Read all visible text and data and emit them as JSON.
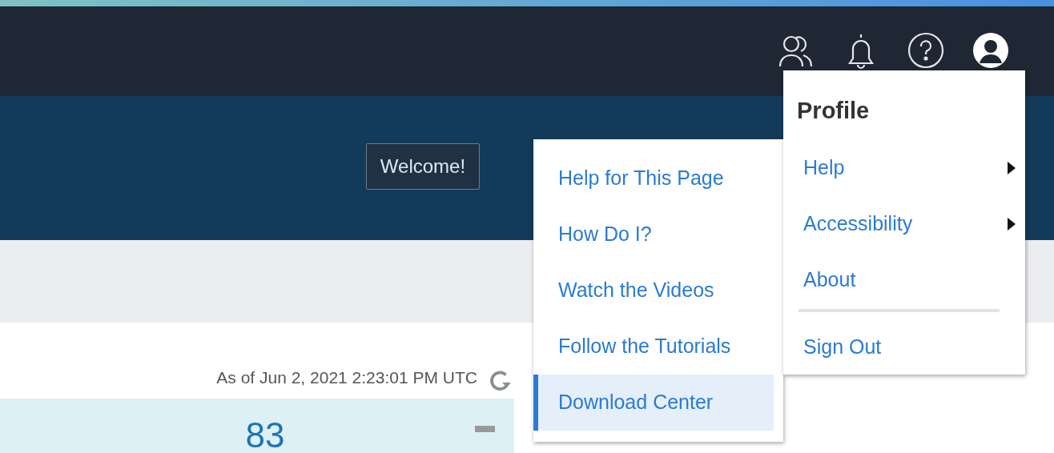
{
  "banner": {
    "welcome_button": "Welcome!"
  },
  "content": {
    "timestamp": "As of Jun 2, 2021 2:23:01 PM UTC",
    "card": {
      "value": "83"
    }
  },
  "profile_menu": {
    "title": "Profile",
    "items": [
      {
        "label": "Help",
        "kind": "submenu"
      },
      {
        "label": "Accessibility",
        "kind": "submenu"
      },
      {
        "label": "About",
        "kind": "link"
      },
      {
        "label": "Sign Out",
        "kind": "link"
      }
    ]
  },
  "help_submenu": {
    "items": [
      {
        "label": "Help for This Page",
        "selected": false
      },
      {
        "label": "How Do I?",
        "selected": false
      },
      {
        "label": "Watch the Videos",
        "selected": false
      },
      {
        "label": "Follow the Tutorials",
        "selected": false
      },
      {
        "label": "Download Center",
        "selected": true
      }
    ]
  }
}
